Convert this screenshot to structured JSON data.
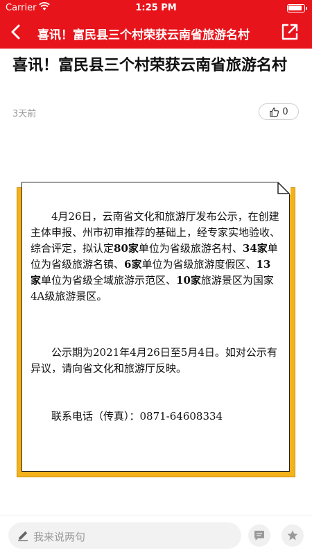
{
  "status_bar": {
    "carrier": "Carrier",
    "time": "1:25 PM"
  },
  "nav": {
    "title": "喜讯！富民县三个村荣获云南省旅游名村",
    "back_icon": "chevron-left-icon",
    "share_icon": "share-icon"
  },
  "article": {
    "title": "喜讯！富民县三个村荣获云南省旅游名村",
    "time_ago": "3天前",
    "like_count": "0"
  },
  "notice": {
    "p1": [
      {
        "t": "4月26日，云南省文化和旅游厅发布公示，在创建主体申报、州市初审推荐的基础上，经专家实地验收、综合评定，拟认定",
        "b": false
      },
      {
        "t": "80家",
        "b": true
      },
      {
        "t": "单位为省级旅游名村、",
        "b": false
      },
      {
        "t": "34家",
        "b": true
      },
      {
        "t": "单位为省级旅游名镇、",
        "b": false
      },
      {
        "t": "6家",
        "b": true
      },
      {
        "t": "单位为省级旅游度假区、",
        "b": false
      },
      {
        "t": "13家",
        "b": true
      },
      {
        "t": "单位为省级全域旅游示范区、",
        "b": false
      },
      {
        "t": "10家",
        "b": true
      },
      {
        "t": "旅游景区为国家4A级旅游景区。",
        "b": false
      }
    ],
    "p2": "公示期为2021年4月26日至5月4日。如对公示有异议，请向省文化和旅游厅反映。",
    "p3": "联系电话（传真）：0871-64608334"
  },
  "footer": {
    "comment_placeholder": "我来说两句"
  },
  "colors": {
    "brand_red": "#e8141b",
    "card_accent": "#f3b21a"
  }
}
